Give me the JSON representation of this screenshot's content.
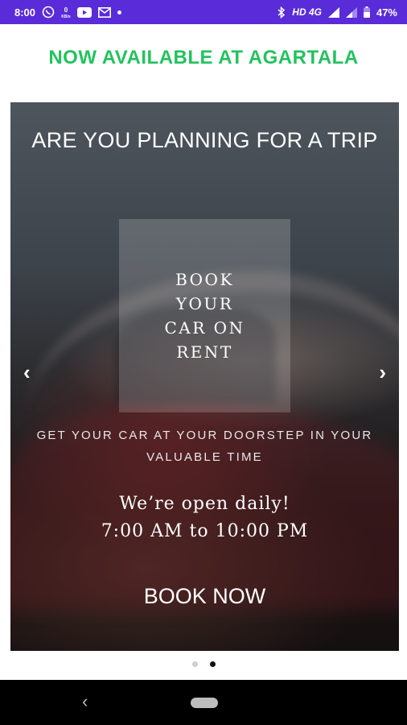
{
  "status_bar": {
    "time": "8:00",
    "left_icons": [
      "whatsapp-icon",
      "data-speed-icon",
      "youtube-icon",
      "gmail-icon",
      "notification-dot-icon"
    ],
    "data_speed": "0\nKB/s",
    "network": "HD 4G",
    "battery": "47%",
    "colors": {
      "background": "#5a2bd8",
      "text": "#ffffff"
    }
  },
  "header": {
    "headline": "NOW AVAILABLE AT AGARTALA",
    "color": "#22c35e"
  },
  "carousel": {
    "title": "ARE YOU PLANNING FOR A TRIP",
    "box_lines": [
      "BOOK",
      "YOUR",
      "CAR ON",
      "RENT"
    ],
    "subtitle": "GET YOUR CAR AT YOUR DOORSTEP IN YOUR VALUABLE TIME",
    "hours_line1": "We’re open daily!",
    "hours_line2": "7:00 AM to 10:00 PM",
    "cta": "BOOK NOW",
    "prev_icon": "chevron-left-icon",
    "next_icon": "chevron-right-icon",
    "prev_glyph": "‹",
    "next_glyph": "›"
  },
  "pager": {
    "count": 2,
    "active_index": 1
  },
  "nav_bar": {
    "back_glyph": "‹",
    "icons": [
      "back-icon",
      "home-pill-icon"
    ]
  }
}
